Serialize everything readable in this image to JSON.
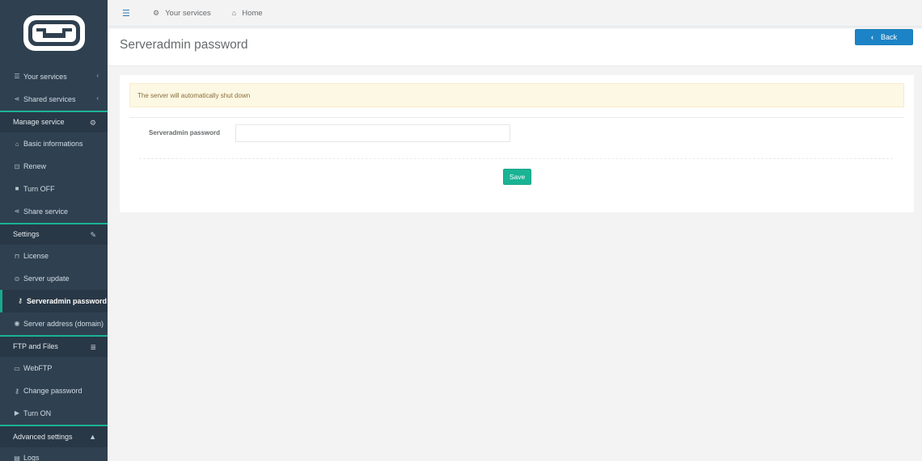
{
  "sidebar": {
    "logo": "gameserver-logo",
    "items": [
      {
        "label": "Your services",
        "icon": "list-icon",
        "glyph": "☰",
        "chevron": "‹",
        "type": "item"
      },
      {
        "label": "Shared services",
        "icon": "share-icon",
        "glyph": "⋖",
        "chevron": "‹",
        "type": "item"
      },
      {
        "label": "Manage service",
        "icon": "gears-icon",
        "glyph": "⚙",
        "type": "section"
      },
      {
        "label": "Basic informations",
        "icon": "home-icon",
        "glyph": "⌂",
        "type": "sub"
      },
      {
        "label": "Renew",
        "icon": "cart-icon",
        "glyph": "⊡",
        "type": "sub"
      },
      {
        "label": "Turn OFF",
        "icon": "stop-icon",
        "glyph": "■",
        "type": "sub"
      },
      {
        "label": "Share service",
        "icon": "share-icon",
        "glyph": "⋖",
        "type": "sub"
      },
      {
        "label": "Settings",
        "icon": "wrench-icon",
        "glyph": "✎",
        "type": "section"
      },
      {
        "label": "License",
        "icon": "bookmark-icon",
        "glyph": "⊓",
        "type": "sub"
      },
      {
        "label": "Server update",
        "icon": "refresh-icon",
        "glyph": "⊙",
        "type": "sub"
      },
      {
        "label": "Serveradmin password",
        "icon": "key-icon",
        "glyph": "⚷",
        "type": "active"
      },
      {
        "label": "Server address (domain)",
        "icon": "globe-icon",
        "glyph": "◉",
        "type": "sub"
      },
      {
        "label": "FTP and Files",
        "icon": "database-icon",
        "glyph": "≣",
        "type": "section"
      },
      {
        "label": "WebFTP",
        "icon": "folder-icon",
        "glyph": "▭",
        "type": "sub"
      },
      {
        "label": "Change password",
        "icon": "key-icon",
        "glyph": "⚷",
        "type": "sub"
      },
      {
        "label": "Turn ON",
        "icon": "play-icon",
        "glyph": "▶",
        "type": "sub"
      },
      {
        "label": "Advanced settings",
        "icon": "warning-icon",
        "glyph": "▲",
        "type": "section"
      },
      {
        "label": "Logs",
        "icon": "file-icon",
        "glyph": "▤",
        "type": "sub"
      }
    ]
  },
  "topbar": {
    "menu_icon": "☰",
    "crumbs": [
      {
        "label": "Your services",
        "icon": "gears-icon",
        "glyph": "⚙"
      },
      {
        "label": "Home",
        "icon": "home-icon",
        "glyph": "⌂"
      }
    ]
  },
  "page": {
    "title": "Serveradmin password",
    "back_label": "Back",
    "back_icon": "‹"
  },
  "form": {
    "alert": "The server will automatically shut down",
    "password_label": "Serveradmin password",
    "password_value": "",
    "save_label": "Save"
  },
  "colors": {
    "sidebar_bg": "#2f4050",
    "accent": "#1ab394",
    "primary": "#1c84c6",
    "warning_bg": "#fcf8e3"
  }
}
